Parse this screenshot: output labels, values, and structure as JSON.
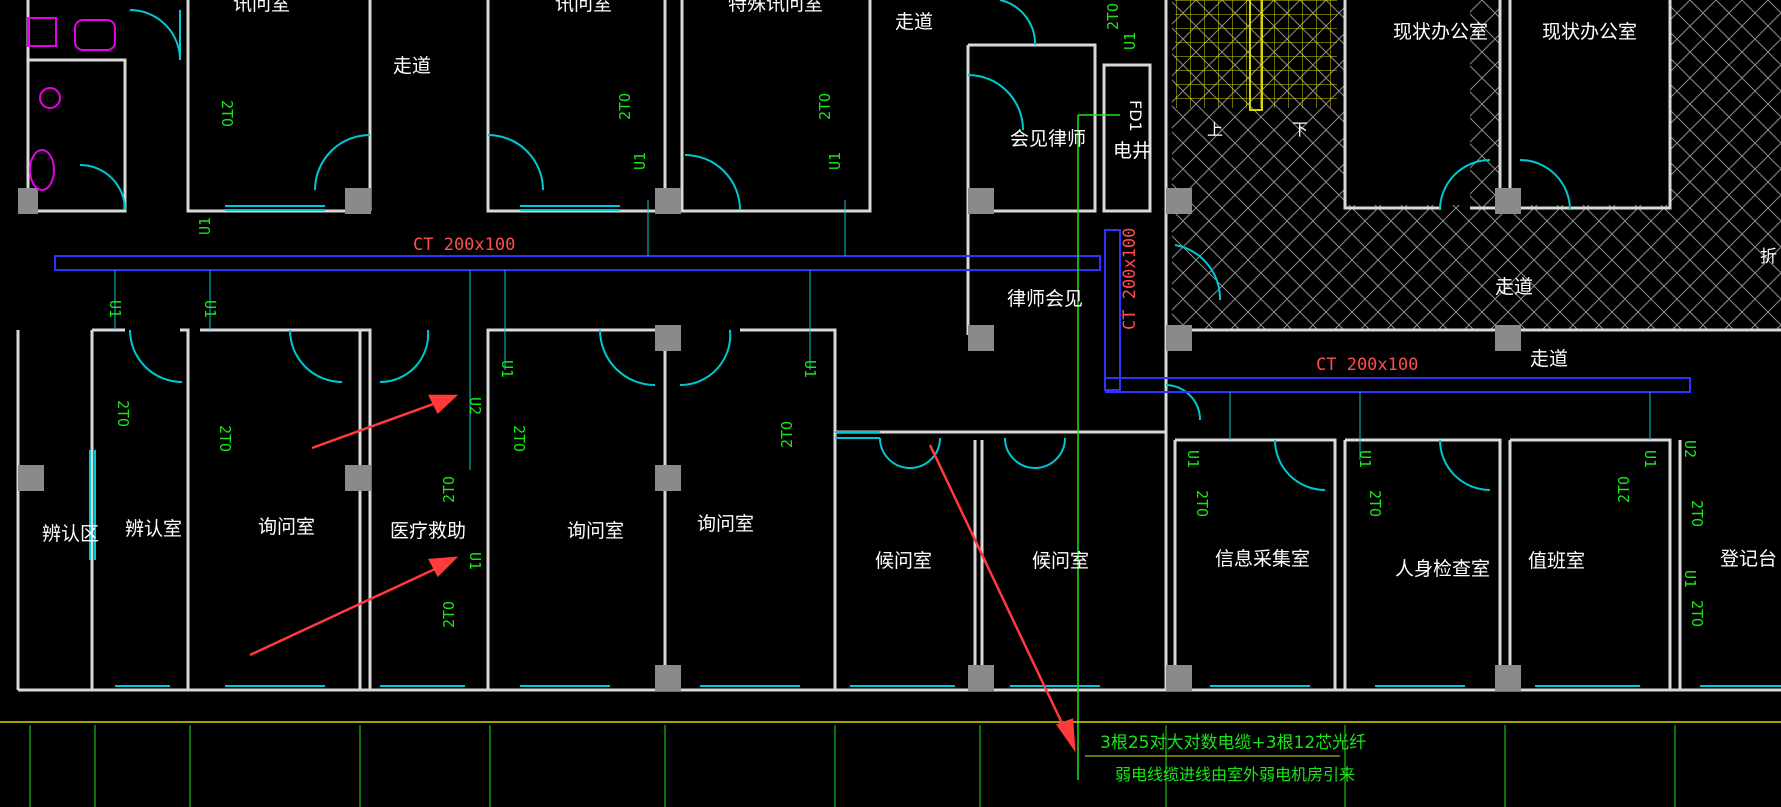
{
  "rooms": [
    {
      "key": "r1",
      "label": "讯问室"
    },
    {
      "key": "r2",
      "label": "讯问室"
    },
    {
      "key": "r3",
      "label": "特殊讯问室"
    },
    {
      "key": "r4",
      "label": "走道"
    },
    {
      "key": "r5",
      "label": "走道"
    },
    {
      "key": "r6",
      "label": "会见律师"
    },
    {
      "key": "r7",
      "label": "电井"
    },
    {
      "key": "r8",
      "label": "FD1"
    },
    {
      "key": "r9",
      "label": "现状办公室"
    },
    {
      "key": "r10",
      "label": "现状办公室"
    },
    {
      "key": "r11",
      "label": "律师会见"
    },
    {
      "key": "r12",
      "label": "走道"
    },
    {
      "key": "r13",
      "label": "走道"
    },
    {
      "key": "r14",
      "label": "辨认区"
    },
    {
      "key": "r15",
      "label": "辨认室"
    },
    {
      "key": "r16",
      "label": "询问室"
    },
    {
      "key": "r17",
      "label": "医疗救助"
    },
    {
      "key": "r18",
      "label": "询问室"
    },
    {
      "key": "r19",
      "label": "询问室"
    },
    {
      "key": "r20",
      "label": "候问室"
    },
    {
      "key": "r21",
      "label": "候问室"
    },
    {
      "key": "r22",
      "label": "信息采集室"
    },
    {
      "key": "r23",
      "label": "人身检查室"
    },
    {
      "key": "r24",
      "label": "值班室"
    },
    {
      "key": "r25",
      "label": "登记台"
    },
    {
      "key": "r26",
      "label": "上"
    },
    {
      "key": "r27",
      "label": "下"
    },
    {
      "key": "r28",
      "label": "折"
    }
  ],
  "trays": [
    {
      "key": "t1",
      "label": "CT 200x100"
    },
    {
      "key": "t2",
      "label": "CT 200x100"
    },
    {
      "key": "t3",
      "label": "CT 200x100"
    }
  ],
  "outlets": {
    "data": "2TO",
    "u1": "U1",
    "u2": "U2"
  },
  "notes": {
    "line1": "3根25对大对数电缆+3根12芯光纤",
    "line2": "弱电线缆进线由室外弱电机房引来"
  },
  "colors": {
    "wall": "#d9d9d9",
    "door": "#00c8d2",
    "tray": "#3030ff",
    "tag": "#19e619",
    "arrow": "#ff3a3a",
    "pink": "#e600e6",
    "yellow": "#d6d600",
    "hatch": "#9a9a9a"
  }
}
